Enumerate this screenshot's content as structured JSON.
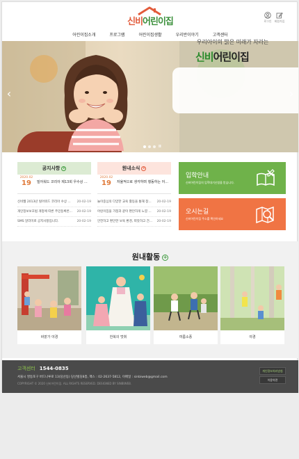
{
  "header": {
    "logo_part1": "신비",
    "logo_part2": "어린이집",
    "util": [
      {
        "label": "로그인",
        "icon": "user-icon"
      },
      {
        "label": "회원가입",
        "icon": "edit-icon"
      }
    ],
    "nav": [
      "어린이집소개",
      "프로그램",
      "어린이집생활",
      "우리반이야기",
      "고객센터"
    ]
  },
  "hero": {
    "caption_line1": "우리아이의 밝은 미래가 자라는",
    "caption_brand_a": "신비",
    "caption_brand_b": "어린이집",
    "pager": "II"
  },
  "notice": {
    "title": "공지사항",
    "accent": "#dcebd3",
    "featured": {
      "ym": "2020.02",
      "day": "19",
      "text": "빌어워드 코리아 제13회 우수상 ..."
    },
    "rows": [
      {
        "text": "신비웹 2013년 빌어워드 코리아 수상 ...",
        "date": "20-02-19"
      },
      {
        "text": "개인정보보호법 개정에 따른 주민등록번...",
        "date": "20-02-19"
      },
      {
        "text": "SMS 알리미로 공지사항입니다.",
        "date": "20-02-19"
      }
    ]
  },
  "news": {
    "title": "원내소식",
    "accent": "#fde4dd",
    "featured": {
      "ym": "2020.02",
      "day": "19",
      "text": "자율적으로 생각하며 행동하는 어..."
    },
    "rows": [
      {
        "text": "놀이중심의 다양한 교육 활동을 통해 창...",
        "date": "20-02-19"
      },
      {
        "text": "어린이집을 가정과 같이 편안하게 느낄 ...",
        "date": "20-02-19"
      },
      {
        "text": "안전하고 편안한 보육 환경, 따뜻하고 건...",
        "date": "20-02-19"
      }
    ]
  },
  "tiles": [
    {
      "title": "입학안내",
      "sub": "신비어린이집의 입학대기신청을 받습니다.",
      "color": "#6fb24a",
      "icon": "book-icon"
    },
    {
      "title": "오시는길",
      "sub": "신비어린이집 주소를 확인하세요",
      "color": "#f07444",
      "icon": "map-search-icon"
    }
  ],
  "activities": {
    "title": "원내활동",
    "cards": [
      {
        "label": "바깥가 야경"
      },
      {
        "label": "한복의 멋휘"
      },
      {
        "label": "여름소풍"
      },
      {
        "label": "야경"
      }
    ]
  },
  "footer": {
    "cs_label": "고객센터",
    "cs_phone": "1544-0835",
    "address": "서울시 영등포구 버드나루로 13(당산동) 당산빌딩8층, 팩스 : 02-2637-5812, 이메일 : sinbiweb@gmail.com",
    "copyright": "COPYRIGHT © 2020 신비어린이집. ALL RIGHTS RESERVED. DESIGNED BY SINBIWEB.",
    "buttons": [
      "개인정보처리방침",
      "이용약관"
    ]
  }
}
